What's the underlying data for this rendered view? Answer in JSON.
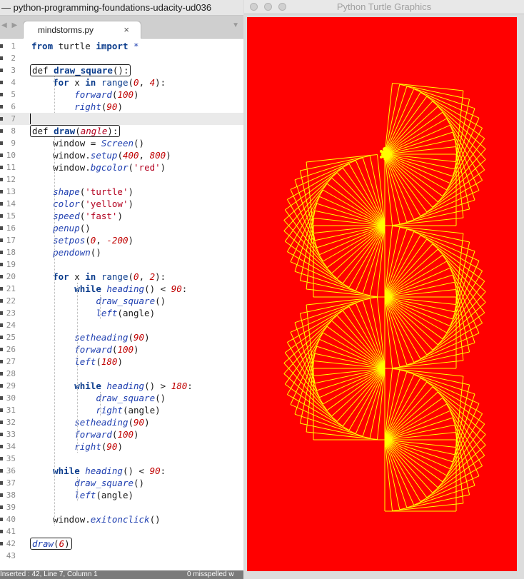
{
  "editor": {
    "window_title": "— python-programming-foundations-udacity-ud036",
    "tab": {
      "label": "mindstorms.py",
      "close": "×"
    },
    "nav_arrows": "◀ ▶",
    "tab_dropdown": "▼",
    "current_line": 7,
    "lines": [
      {
        "n": 1,
        "fold": true,
        "html": "<span class='kw'>from</span> turtle <span class='kw'>import</span> <span style='color:#1f3fb0'>*</span>"
      },
      {
        "n": 2,
        "fold": true,
        "html": ""
      },
      {
        "n": 3,
        "fold": true,
        "html": "<span class='boxed'><span>def</span> <span class='kw'>draw_square</span>():</span>"
      },
      {
        "n": 4,
        "fold": true,
        "html": "    <span class='kw'>for</span> x <span class='kw'>in</span> <span class='kw' style='font-weight:normal;color:#0b3c8c'>range</span>(<span class='n'>0</span>, <span class='n'>4</span>):"
      },
      {
        "n": 5,
        "fold": true,
        "html": "        <span class='fn'>forward</span>(<span class='n'>100</span>)"
      },
      {
        "n": 6,
        "fold": true,
        "html": "        <span class='fn'>right</span>(<span class='n'>90</span>)"
      },
      {
        "n": 7,
        "fold": true,
        "html": ""
      },
      {
        "n": 8,
        "fold": true,
        "html": "<span class='boxed'><span>def</span> <span class='kw'>draw</span>(<span class='fn' style='color:#b3001f'>angle</span>):</span>"
      },
      {
        "n": 9,
        "fold": true,
        "html": "    window = <span class='fn'>Screen</span>()"
      },
      {
        "n": 10,
        "fold": true,
        "html": "    window.<span class='fn'>setup</span>(<span class='n'>400</span>, <span class='n'>800</span>)"
      },
      {
        "n": 11,
        "fold": true,
        "html": "    window.<span class='fn'>bgcolor</span>(<span class='str'>'red'</span>)"
      },
      {
        "n": 12,
        "fold": true,
        "html": ""
      },
      {
        "n": 13,
        "fold": true,
        "html": "    <span class='fn'>shape</span>(<span class='str'>'turtle'</span>)"
      },
      {
        "n": 14,
        "fold": true,
        "html": "    <span class='fn'>color</span>(<span class='str'>'yellow'</span>)"
      },
      {
        "n": 15,
        "fold": true,
        "html": "    <span class='fn'>speed</span>(<span class='str'>'fast'</span>)"
      },
      {
        "n": 16,
        "fold": true,
        "html": "    <span class='fn'>penup</span>()"
      },
      {
        "n": 17,
        "fold": true,
        "html": "    <span class='fn'>setpos</span>(<span class='n'>0</span>, <span class='n'>-200</span>)"
      },
      {
        "n": 18,
        "fold": true,
        "html": "    <span class='fn'>pendown</span>()"
      },
      {
        "n": 19,
        "fold": true,
        "html": ""
      },
      {
        "n": 20,
        "fold": true,
        "html": "    <span class='kw'>for</span> x <span class='kw'>in</span> <span style='color:#0b3c8c'>range</span>(<span class='n'>0</span>, <span class='n'>2</span>):"
      },
      {
        "n": 21,
        "fold": true,
        "html": "        <span class='kw'>while</span> <span class='fn'>heading</span>() &lt; <span class='n'>90</span>:"
      },
      {
        "n": 22,
        "fold": true,
        "html": "            <span class='fn'>draw_square</span>()"
      },
      {
        "n": 23,
        "fold": true,
        "html": "            <span class='fn'>left</span>(angle)"
      },
      {
        "n": 24,
        "fold": true,
        "html": ""
      },
      {
        "n": 25,
        "fold": true,
        "html": "        <span class='fn'>setheading</span>(<span class='n'>90</span>)"
      },
      {
        "n": 26,
        "fold": true,
        "html": "        <span class='fn'>forward</span>(<span class='n'>100</span>)"
      },
      {
        "n": 27,
        "fold": true,
        "html": "        <span class='fn'>left</span>(<span class='n'>180</span>)"
      },
      {
        "n": 28,
        "fold": true,
        "html": ""
      },
      {
        "n": 29,
        "fold": true,
        "html": "        <span class='kw'>while</span> <span class='fn'>heading</span>() &gt; <span class='n'>180</span>:"
      },
      {
        "n": 30,
        "fold": true,
        "html": "            <span class='fn'>draw_square</span>()"
      },
      {
        "n": 31,
        "fold": true,
        "html": "            <span class='fn'>right</span>(angle)"
      },
      {
        "n": 32,
        "fold": true,
        "html": "        <span class='fn'>setheading</span>(<span class='n'>90</span>)"
      },
      {
        "n": 33,
        "fold": true,
        "html": "        <span class='fn'>forward</span>(<span class='n'>100</span>)"
      },
      {
        "n": 34,
        "fold": true,
        "html": "        <span class='fn'>right</span>(<span class='n'>90</span>)"
      },
      {
        "n": 35,
        "fold": true,
        "html": ""
      },
      {
        "n": 36,
        "fold": true,
        "html": "    <span class='kw'>while</span> <span class='fn'>heading</span>() &lt; <span class='n'>90</span>:"
      },
      {
        "n": 37,
        "fold": true,
        "html": "        <span class='fn'>draw_square</span>()"
      },
      {
        "n": 38,
        "fold": true,
        "html": "        <span class='fn'>left</span>(angle)"
      },
      {
        "n": 39,
        "fold": true,
        "html": ""
      },
      {
        "n": 40,
        "fold": true,
        "html": "    window.<span class='fn'>exitonclick</span>()"
      },
      {
        "n": 41,
        "fold": true,
        "html": ""
      },
      {
        "n": 42,
        "fold": true,
        "html": "<span class='boxed'><span class='fn'>draw</span>(<span class='n'>6</span>)</span>"
      },
      {
        "n": 43,
        "fold": false,
        "html": ""
      }
    ],
    "status_left": "Inserted : 42, Line 7, Column 1",
    "status_right": "0 misspelled w"
  },
  "turtle_window": {
    "title": "Python Turtle Graphics",
    "bgcolor": "#ff0000",
    "pen_color": "#ffff00"
  },
  "colors": {
    "keyword": "#0b3c8c",
    "function": "#1f3fb0",
    "string": "#b3001f",
    "number": "#c00000"
  }
}
